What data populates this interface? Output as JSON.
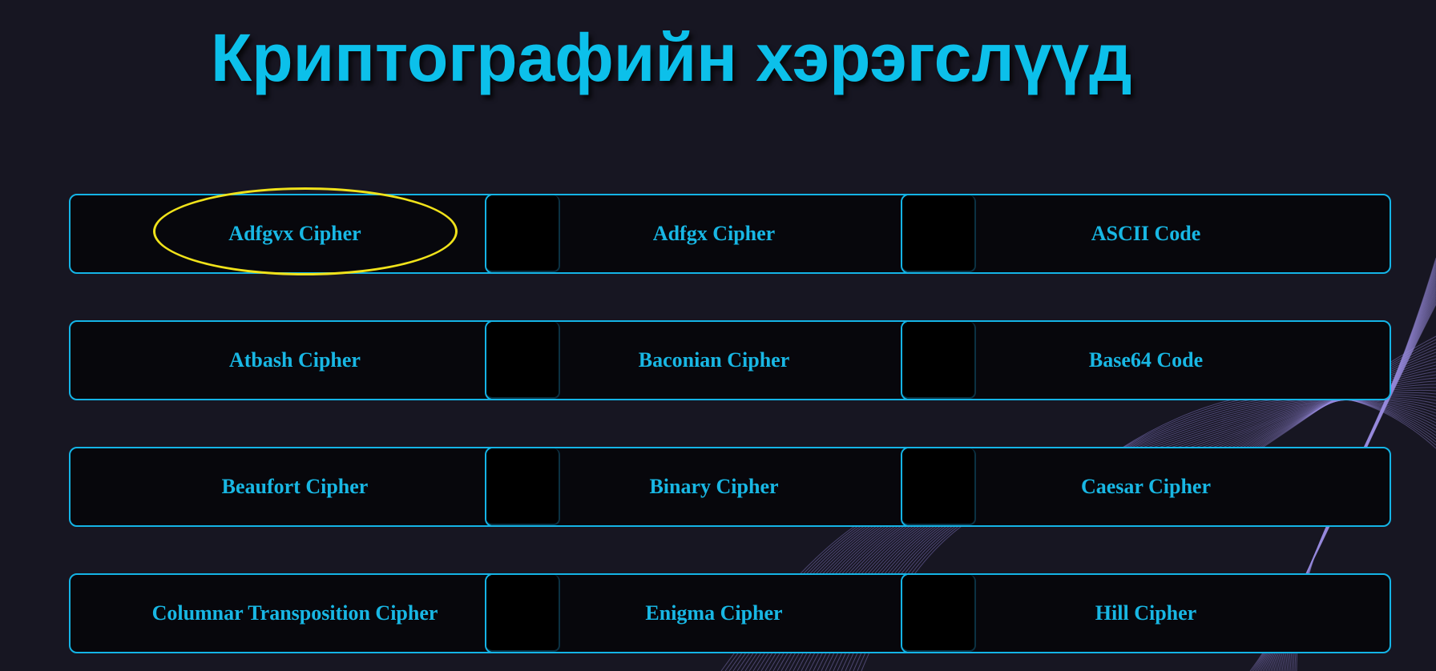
{
  "page": {
    "title": "Криптографийн хэрэгслүүд"
  },
  "tools": [
    [
      "Adfgvx Cipher",
      "Adfgx Cipher",
      "ASCII Code"
    ],
    [
      "Atbash Cipher",
      "Baconian Cipher",
      "Base64 Code"
    ],
    [
      "Beaufort Cipher",
      "Binary Cipher",
      "Caesar Cipher"
    ],
    [
      "Columnar Transposition Cipher",
      "Enigma Cipher",
      "Hill Cipher"
    ]
  ],
  "highlighted_tool": "Adfgvx Cipher",
  "colors": {
    "background": "#171622",
    "accent": "#14b4e6",
    "title": "#0cc0ea",
    "highlight": "#f0e21a",
    "card_background": "#07070c"
  }
}
